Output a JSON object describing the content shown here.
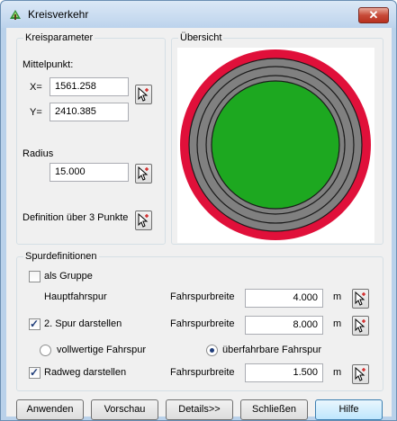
{
  "window": {
    "title": "Kreisverkehr",
    "close_symbol": "✕"
  },
  "kreisparameter": {
    "legend": "Kreisparameter",
    "mittelpunkt_label": "Mittelpunkt:",
    "x_label": "X=",
    "x_value": "1561.258",
    "y_label": "Y=",
    "y_value": "2410.385",
    "radius_label": "Radius",
    "radius_value": "15.000",
    "three_points_label": "Definition über 3 Punkte"
  },
  "uebersicht": {
    "legend": "Übersicht",
    "colors": {
      "outer_ring": "#e0103a",
      "lane": "#808080",
      "center": "#1da820",
      "lines": "#1a1a1a"
    }
  },
  "spurdefinitionen": {
    "legend": "Spurdefinitionen",
    "als_gruppe_label": "als Gruppe",
    "als_gruppe_checked": false,
    "hauptfahrspur_label": "Hauptfahrspur",
    "fahrspurbreite_label": "Fahrspurbreite",
    "hauptfahrspur_value": "4.000",
    "unit": "m",
    "spur2_label": "2. Spur darstellen",
    "spur2_checked": true,
    "spur2_value": "8.000",
    "radio_vollwertig_label": "vollwertige Fahrspur",
    "radio_ueberfahrbar_label": "überfahrbare Fahrspur",
    "selected_radio": "überfahrbare Fahrspur",
    "radweg_label": "Radweg darstellen",
    "radweg_checked": true,
    "radweg_value": "1.500"
  },
  "buttons": {
    "anwenden": "Anwenden",
    "vorschau": "Vorschau",
    "details": "Details>>",
    "schliessen": "Schließen",
    "hilfe": "Hilfe"
  }
}
